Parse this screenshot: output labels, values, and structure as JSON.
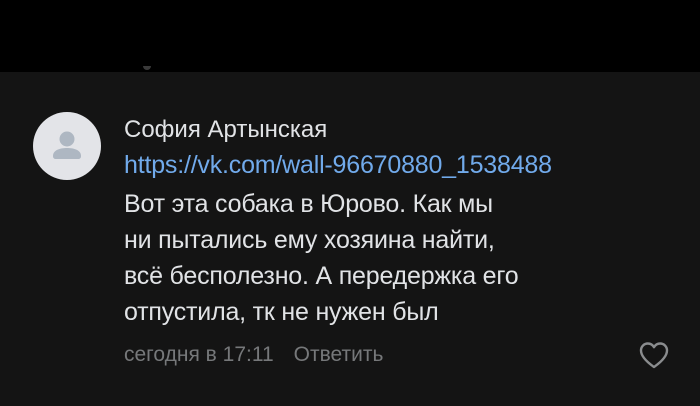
{
  "comment": {
    "author": "София Артынская",
    "link": "https://vk.com/wall-96670880_1538488",
    "text_lines": [
      "Вот эта собака в Юрово. Как мы",
      "ни пытались ему хозяина найти,",
      "всё бесполезно. А передержка его",
      "отпустила, тк не нужен был"
    ],
    "timestamp": "сегодня в 17:11",
    "reply_label": "Ответить",
    "avatar_icon": "user-placeholder-icon",
    "like_icon": "heart-outline-icon"
  },
  "colors": {
    "background": "#141414",
    "top_band": "#000000",
    "text": "#e1e3e6",
    "link": "#71aaeb",
    "secondary": "#76787a",
    "avatar_bg": "#e3e4e8",
    "avatar_fg": "#aeb7c2"
  }
}
